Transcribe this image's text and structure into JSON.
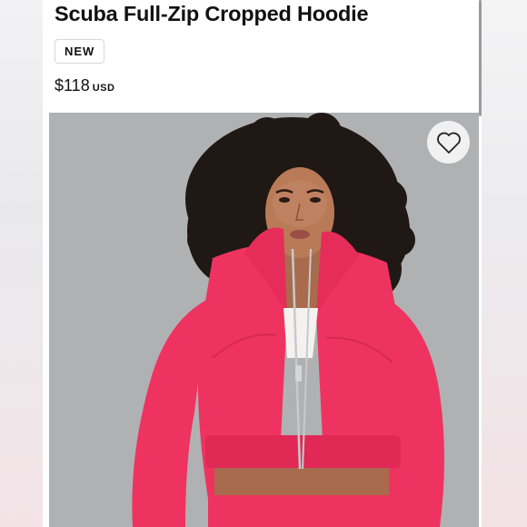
{
  "product": {
    "title": "Scuba Full-Zip Cropped Hoodie",
    "badge": "NEW",
    "price_amount": "$118",
    "price_currency": "USD"
  },
  "image": {
    "wishlist_icon": "heart-outline-icon",
    "hoodie_color": "#ef3561",
    "background_color": "#afb0b2"
  }
}
